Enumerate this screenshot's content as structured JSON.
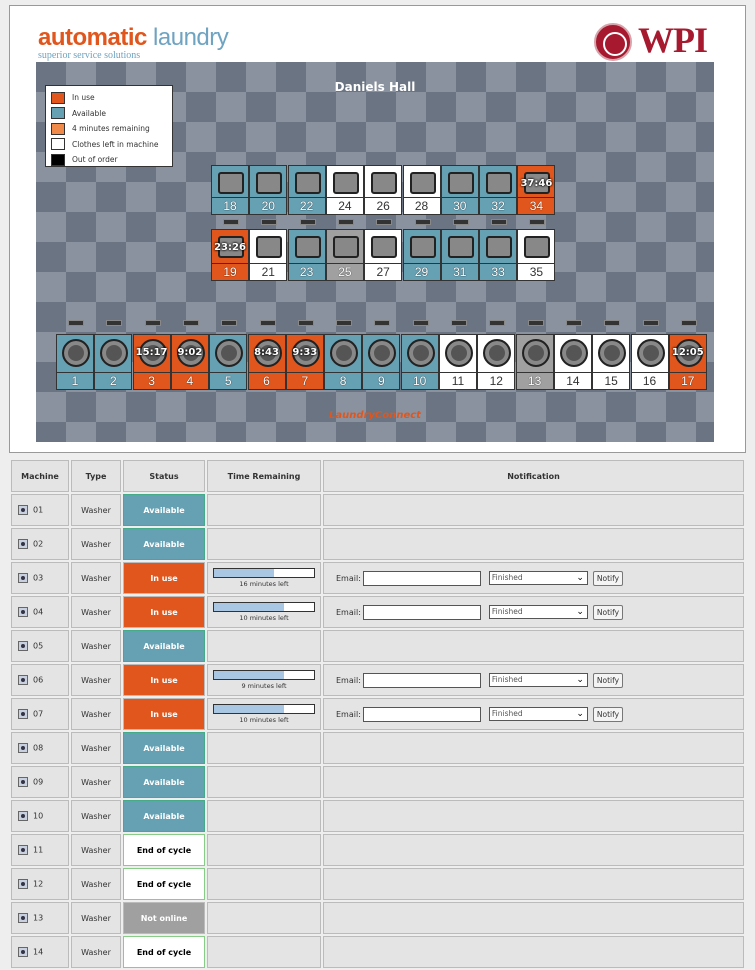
{
  "header": {
    "logo_a": "autom",
    "logo_dot": "a",
    "logo_b": "tic",
    "logo_c": " laundry",
    "logo_sub": "superior service solutions",
    "wpi": "WPI"
  },
  "room": {
    "hall_name": "Daniels Hall",
    "brand": "LaundryConnect"
  },
  "legend": [
    {
      "label": "In use",
      "color": "#e0561c"
    },
    {
      "label": "Available",
      "color": "#66a0b3"
    },
    {
      "label": "4 minutes remaining",
      "color": "#f08a4b"
    },
    {
      "label": "Clothes left in machine",
      "color": "#ffffff"
    },
    {
      "label": "Out of order",
      "color": "#000000"
    }
  ],
  "dryers_top": [
    {
      "num": "18",
      "status": "available"
    },
    {
      "num": "20",
      "status": "available"
    },
    {
      "num": "22",
      "status": "available"
    },
    {
      "num": "24",
      "status": "end"
    },
    {
      "num": "26",
      "status": "end"
    },
    {
      "num": "28",
      "status": "end"
    },
    {
      "num": "30",
      "status": "available"
    },
    {
      "num": "32",
      "status": "available"
    },
    {
      "num": "34",
      "status": "inuse",
      "time": "37:46"
    }
  ],
  "dryers_bottom": [
    {
      "num": "19",
      "status": "inuse",
      "time": "23:26"
    },
    {
      "num": "21",
      "status": "end"
    },
    {
      "num": "23",
      "status": "available"
    },
    {
      "num": "25",
      "status": "offline"
    },
    {
      "num": "27",
      "status": "end"
    },
    {
      "num": "29",
      "status": "available"
    },
    {
      "num": "31",
      "status": "available"
    },
    {
      "num": "33",
      "status": "available"
    },
    {
      "num": "35",
      "status": "end"
    }
  ],
  "washers": [
    {
      "num": "1",
      "status": "available"
    },
    {
      "num": "2",
      "status": "available"
    },
    {
      "num": "3",
      "status": "inuse",
      "time": "15:17"
    },
    {
      "num": "4",
      "status": "inuse",
      "time": "9:02"
    },
    {
      "num": "5",
      "status": "available"
    },
    {
      "num": "6",
      "status": "inuse",
      "time": "8:43"
    },
    {
      "num": "7",
      "status": "inuse",
      "time": "9:33"
    },
    {
      "num": "8",
      "status": "available"
    },
    {
      "num": "9",
      "status": "available"
    },
    {
      "num": "10",
      "status": "available"
    },
    {
      "num": "11",
      "status": "end"
    },
    {
      "num": "12",
      "status": "end"
    },
    {
      "num": "13",
      "status": "offline"
    },
    {
      "num": "14",
      "status": "end"
    },
    {
      "num": "15",
      "status": "end"
    },
    {
      "num": "16",
      "status": "end"
    },
    {
      "num": "17",
      "status": "inuse",
      "time": "12:05"
    }
  ],
  "table": {
    "headers": {
      "machine": "Machine",
      "type": "Type",
      "status": "Status",
      "time": "Time Remaining",
      "notification": "Notification"
    },
    "email_label": "Email:",
    "select_value": "Finished",
    "notify_label": "Notify",
    "rows": [
      {
        "machine": "01",
        "type": "Washer",
        "status": "Available",
        "kind": "av"
      },
      {
        "machine": "02",
        "type": "Washer",
        "status": "Available",
        "kind": "av"
      },
      {
        "machine": "03",
        "type": "Washer",
        "status": "In use",
        "kind": "use",
        "progress": 0.6,
        "time_left": "16 minutes left"
      },
      {
        "machine": "04",
        "type": "Washer",
        "status": "In use",
        "kind": "use",
        "progress": 0.7,
        "time_left": "10 minutes left"
      },
      {
        "machine": "05",
        "type": "Washer",
        "status": "Available",
        "kind": "av"
      },
      {
        "machine": "06",
        "type": "Washer",
        "status": "In use",
        "kind": "use",
        "progress": 0.7,
        "time_left": "9 minutes left"
      },
      {
        "machine": "07",
        "type": "Washer",
        "status": "In use",
        "kind": "use",
        "progress": 0.7,
        "time_left": "10 minutes left"
      },
      {
        "machine": "08",
        "type": "Washer",
        "status": "Available",
        "kind": "av"
      },
      {
        "machine": "09",
        "type": "Washer",
        "status": "Available",
        "kind": "av"
      },
      {
        "machine": "10",
        "type": "Washer",
        "status": "Available",
        "kind": "av"
      },
      {
        "machine": "11",
        "type": "Washer",
        "status": "End of cycle",
        "kind": "end"
      },
      {
        "machine": "12",
        "type": "Washer",
        "status": "End of cycle",
        "kind": "end"
      },
      {
        "machine": "13",
        "type": "Washer",
        "status": "Not online",
        "kind": "off"
      },
      {
        "machine": "14",
        "type": "Washer",
        "status": "End of cycle",
        "kind": "end"
      }
    ]
  }
}
